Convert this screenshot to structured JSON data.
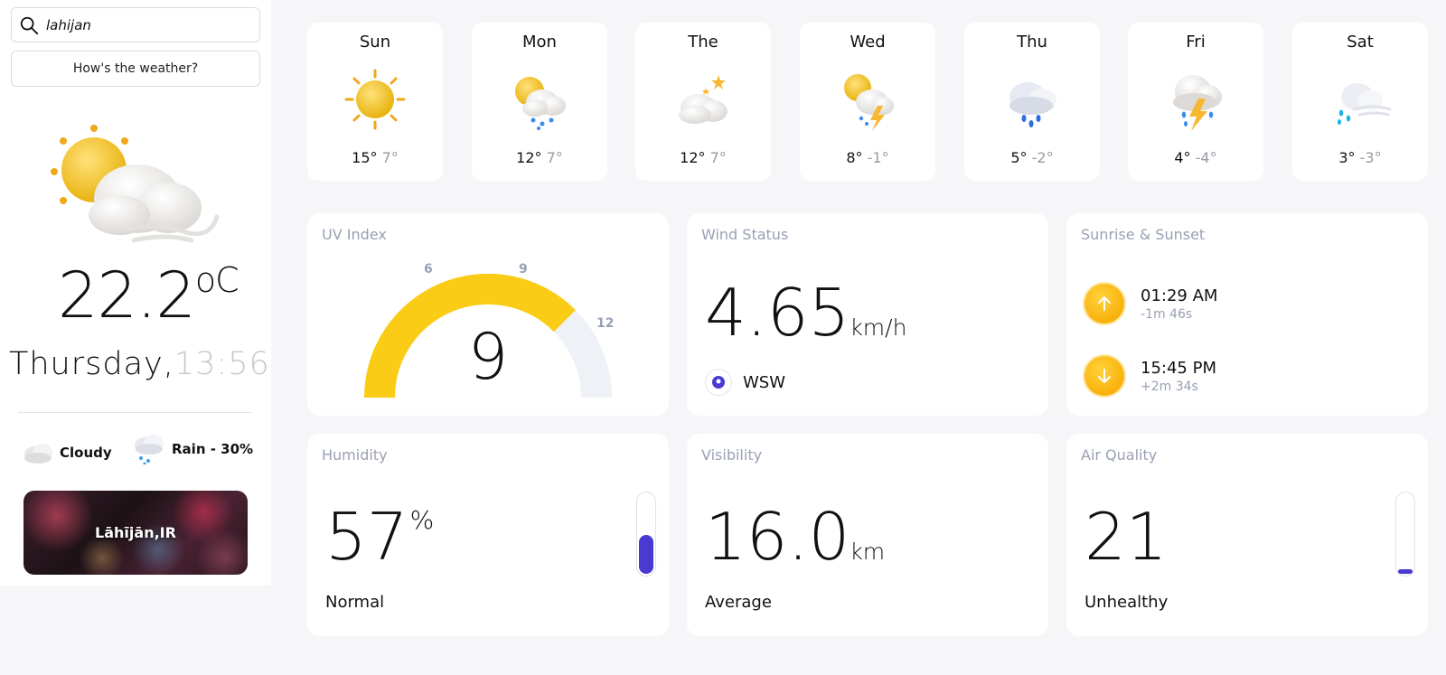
{
  "search": {
    "value": "lahijan",
    "placeholder": ""
  },
  "ask_button": "How's the weather?",
  "current": {
    "temperature": "22.2",
    "unit": "oC",
    "day": "Thursday,",
    "time": "13:56",
    "icon": "sun-cloud-wind-icon",
    "conditions": [
      {
        "label": "Cloudy",
        "icon": "cloud-icon"
      },
      {
        "label": "Rain - 30%",
        "icon": "rain-cloud-icon"
      }
    ],
    "city": "Lāhījān,IR"
  },
  "forecast": [
    {
      "day": "Sun",
      "high": "15°",
      "low": "7°",
      "icon": "sun-icon"
    },
    {
      "day": "Mon",
      "high": "12°",
      "low": "7°",
      "icon": "sun-rain-cloud-icon"
    },
    {
      "day": "The",
      "high": "12°",
      "low": "7°",
      "icon": "cloud-stars-icon"
    },
    {
      "day": "Wed",
      "high": "8°",
      "low": "-1°",
      "icon": "sun-thunder-cloud-icon"
    },
    {
      "day": "Thu",
      "high": "5°",
      "low": "-2°",
      "icon": "rain-snow-cloud-icon"
    },
    {
      "day": "Fri",
      "high": "4°",
      "low": "-4°",
      "icon": "thunder-rain-cloud-icon"
    },
    {
      "day": "Sat",
      "high": "3°",
      "low": "-3°",
      "icon": "wind-rain-cloud-icon"
    }
  ],
  "highlights": {
    "uv": {
      "title": "UV Index",
      "value": "9",
      "max": 12,
      "ticks": [
        "6",
        "9",
        "12"
      ],
      "fill_color": "#facc15",
      "track_color": "#eef1f6"
    },
    "wind": {
      "title": "Wind Status",
      "speed": "4.65",
      "unit": "km/h",
      "direction": "WSW"
    },
    "sun": {
      "title": "Sunrise & Sunset",
      "sunrise": "01:29 AM",
      "sunrise_delta": "-1m 46s",
      "sunset": "15:45 PM",
      "sunset_delta": "+2m 34s"
    },
    "humidity": {
      "title": "Humidity",
      "value": "57",
      "unit": "%",
      "status": "Normal",
      "level": 0.57
    },
    "visibility": {
      "title": "Visibility",
      "value": "16.0",
      "unit": "km",
      "status": "Average"
    },
    "air_quality": {
      "title": "Air Quality",
      "value": "21",
      "status": "Unhealthy",
      "level": 0.06
    }
  },
  "colors": {
    "accent": "#4a3ad1",
    "sun": "#f9b10c",
    "muted": "#9aa0b4"
  }
}
